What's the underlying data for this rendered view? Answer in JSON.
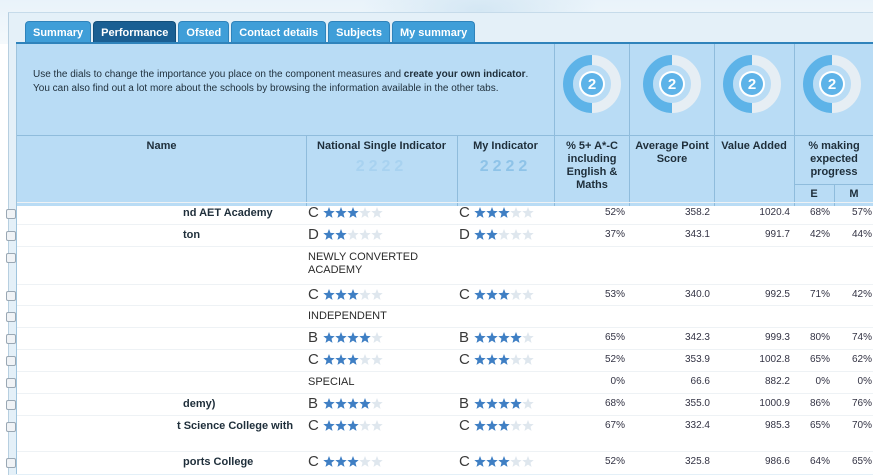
{
  "tabs": [
    {
      "label": "Summary",
      "active": false
    },
    {
      "label": "Performance",
      "active": true
    },
    {
      "label": "Ofsted",
      "active": false
    },
    {
      "label": "Contact details",
      "active": false
    },
    {
      "label": "Subjects",
      "active": false
    },
    {
      "label": "My summary",
      "active": false
    }
  ],
  "intro": {
    "part1": "Use the dials to change the importance you place on the component measures and ",
    "bold": "create your own indicator",
    "part2": ". You can also find out a lot more about the schools by browsing the information available in the other tabs."
  },
  "dials": [
    {
      "value": "2",
      "name": "dial-five-a-star-c"
    },
    {
      "value": "2",
      "name": "dial-average-point-score"
    },
    {
      "value": "2",
      "name": "dial-value-added"
    },
    {
      "value": "2",
      "name": "dial-expected-progress"
    }
  ],
  "columns": {
    "name": "Name",
    "national": "National Single Indicator",
    "national_ghost": "2222",
    "my": "My Indicator",
    "my_ghost": "2222",
    "five_a_c": "% 5+ A*-C including English & Maths",
    "aps": "Average Point Score",
    "va": "Value Added",
    "progress": "% making expected progress",
    "progress_e": "E",
    "progress_m": "M"
  },
  "rows": [
    {
      "name": "nd AET Academy",
      "nat_grade": "C",
      "nat_stars": 3,
      "my_grade": "C",
      "my_stars": 3,
      "five_a_c": "52%",
      "aps": "358.2",
      "va": "1020.4",
      "e": "68%",
      "m": "57%"
    },
    {
      "name": "ton",
      "nat_grade": "D",
      "nat_stars": 2,
      "my_grade": "D",
      "my_stars": 2,
      "five_a_c": "37%",
      "aps": "343.1",
      "va": "991.7",
      "e": "42%",
      "m": "44%"
    },
    {
      "name": "",
      "note": "NEWLY CONVERTED ACADEMY"
    },
    {
      "name": "",
      "nat_grade": "C",
      "nat_stars": 3,
      "my_grade": "C",
      "my_stars": 3,
      "five_a_c": "53%",
      "aps": "340.0",
      "va": "992.5",
      "e": "71%",
      "m": "42%"
    },
    {
      "name": "",
      "note": "INDEPENDENT"
    },
    {
      "name": "",
      "nat_grade": "B",
      "nat_stars": 4,
      "my_grade": "B",
      "my_stars": 4,
      "five_a_c": "65%",
      "aps": "342.3",
      "va": "999.3",
      "e": "80%",
      "m": "74%"
    },
    {
      "name": "",
      "nat_grade": "C",
      "nat_stars": 3,
      "my_grade": "C",
      "my_stars": 3,
      "five_a_c": "52%",
      "aps": "353.9",
      "va": "1002.8",
      "e": "65%",
      "m": "62%"
    },
    {
      "name": "",
      "note": "SPECIAL",
      "five_a_c": "0%",
      "aps": "66.6",
      "va": "882.2",
      "e": "0%",
      "m": "0%"
    },
    {
      "name": "demy)",
      "nat_grade": "B",
      "nat_stars": 4,
      "my_grade": "B",
      "my_stars": 4,
      "five_a_c": "68%",
      "aps": "355.0",
      "va": "1000.9",
      "e": "86%",
      "m": "76%"
    },
    {
      "name": "t Science College with",
      "nat_grade": "C",
      "nat_stars": 3,
      "my_grade": "C",
      "my_stars": 3,
      "five_a_c": "67%",
      "aps": "332.4",
      "va": "985.3",
      "e": "65%",
      "m": "70%"
    },
    {
      "name": "ports College",
      "nat_grade": "C",
      "nat_stars": 3,
      "my_grade": "C",
      "my_stars": 3,
      "five_a_c": "52%",
      "aps": "325.8",
      "va": "986.6",
      "e": "64%",
      "m": "65%"
    }
  ],
  "colors": {
    "tab": "#3f9ed8",
    "tab_active": "#1a5f93",
    "header": "#b9dcf5",
    "star_on": "#3f7fc4",
    "star_off": "#dfe7ee",
    "dial": "#5db3e8"
  }
}
